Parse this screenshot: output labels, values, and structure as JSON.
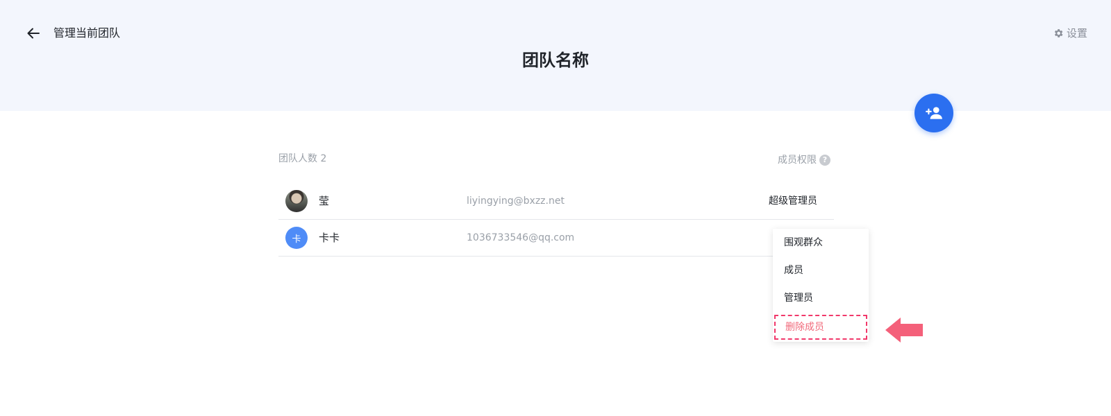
{
  "header": {
    "back_label": "管理当前团队",
    "title": "团队名称",
    "settings_label": "设置"
  },
  "team": {
    "member_count_label": "团队人数 2",
    "permission_label": "成员权限",
    "members": [
      {
        "name": "莹",
        "email": "liyingying@bxzz.net",
        "role": "超级管理员",
        "avatar": "photo"
      },
      {
        "name": "卡卡",
        "email": "1036733546@qq.com",
        "role": "",
        "avatar_letter": "卡"
      }
    ]
  },
  "role_dropdown": {
    "options": [
      "围观群众",
      "成员",
      "管理员",
      "删除成员"
    ]
  },
  "colors": {
    "accent": "#2b6ff0",
    "header_bg": "#f3f6fd",
    "danger": "#f1386a",
    "avatar_blue": "#4f8cf7"
  }
}
